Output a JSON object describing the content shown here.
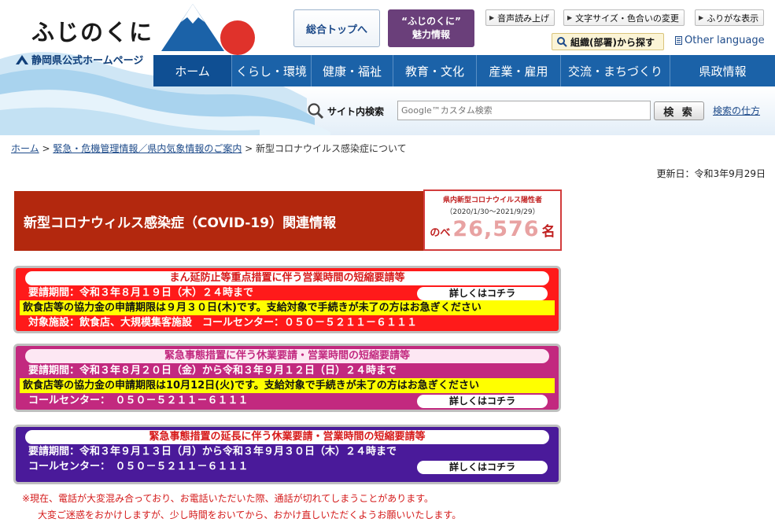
{
  "header": {
    "logo_title": "ふじのくに",
    "logo_subtitle": "静岡県公式ホームページ",
    "top_button": "総合トップへ",
    "charm_button_line1": "“ふじのくに”",
    "charm_button_line2": "魅力情報",
    "util": {
      "voice": "音声読み上げ",
      "textsize": "文字サイズ・色合いの変更",
      "furigana": "ふりがな表示"
    },
    "org_search": "組織(部署)から探す",
    "other_language": "Other language"
  },
  "nav": [
    {
      "label": "ホーム"
    },
    {
      "label": "くらし・環境"
    },
    {
      "label": "健康・福祉"
    },
    {
      "label": "教育・文化"
    },
    {
      "label": "産業・雇用"
    },
    {
      "label": "交流・まちづくり"
    },
    {
      "label": "県政情報"
    }
  ],
  "search": {
    "label": "サイト内検索",
    "placeholder": "Google™カスタム検索",
    "button": "検 索",
    "help": "検索の仕方"
  },
  "breadcrumb": {
    "home": "ホーム",
    "sep1": " > ",
    "parent": "緊急・危機管理情報／県内気象情報のご案内",
    "sep2": " > ",
    "current": "新型コロナウイルス感染症について"
  },
  "updated": "更新日：令和3年9月29日",
  "covid": {
    "banner_title": "新型コロナウィルス感染症（COVID-19）関連情報",
    "count_label": "県内新型コロナウイルス陽性者",
    "count_period": "（2020/1/30〜2021/9/29）",
    "count_prefix": "のべ",
    "count_value": "26,576",
    "count_suffix": "名"
  },
  "notices": [
    {
      "title": "まん延防止等重点措置に伴う営業時間の短縮要請等",
      "period": "要請期間：令和３年８月１９日（木）２４時まで",
      "deadline": "飲食店等の協力金の申請期限は９月３０日(木)です。支給対象で手続きが未了の方はお急ぎください",
      "extra": "対象施設：飲食店、大規模集客施設　コールセンター：０５０－５２１１－６１１１",
      "more": "詳しくはコチラ"
    },
    {
      "title": "緊急事態措置に伴う休業要請・営業時間の短縮要請等",
      "period": "要請期間：令和３年８月２０日（金）から令和３年９月１２日（日）２４時まで",
      "deadline": "飲食店等の協力金の申請期限は10月12日(火)です。支給対象で手続きが未了の方はお急ぎください",
      "extra": "コールセンター：　０５０－５２１１－６１１１",
      "more": "詳しくはコチラ"
    },
    {
      "title": "緊急事態措置の延長に伴う休業要請・営業時間の短縮要請等",
      "period": "要請期間：令和３年９月１３日（月）から令和３年９月３０日（木）２４時まで",
      "extra": "コールセンター：　０５０－５２１１－６１１１",
      "more": "詳しくはコチラ"
    }
  ],
  "warning": {
    "line1": "※現在、電話が大変混み合っており、お電話いただいた際、通話が切れてしまうことがあります。",
    "line2": "大変ご迷惑をおかけしますが、少し時間をおいてから、おかけ直しいただくようお願いいたします。"
  }
}
